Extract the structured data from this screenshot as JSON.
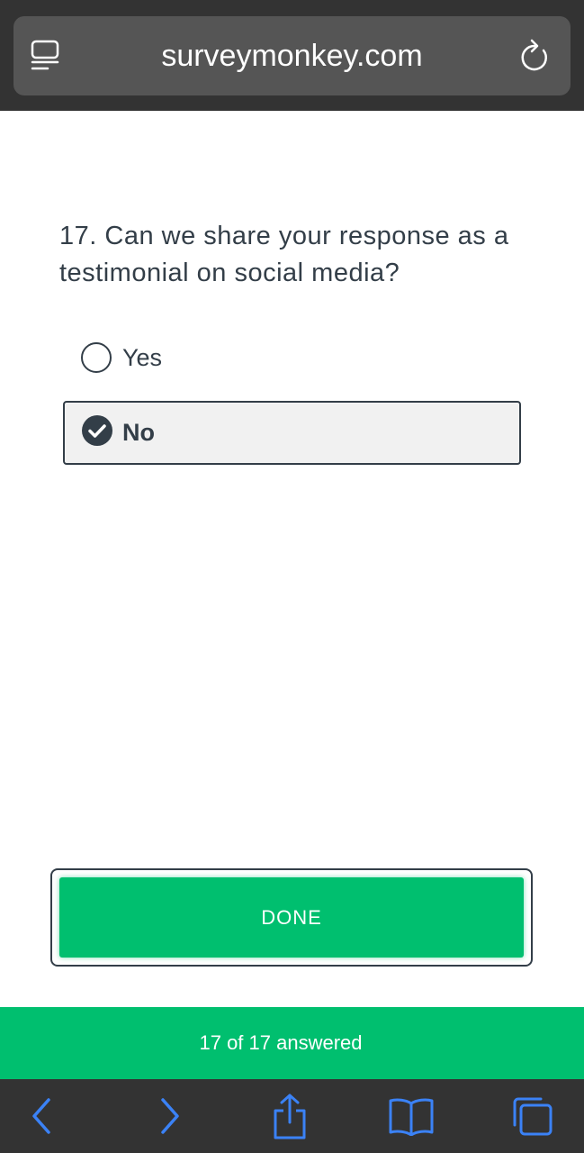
{
  "browser": {
    "url": "surveymonkey.com",
    "icons": {
      "reader": "reader-view-icon",
      "reload": "reload-icon"
    },
    "toolbar": {
      "back": "chevron-left-icon",
      "forward": "chevron-right-icon",
      "share": "share-icon",
      "bookmarks": "book-icon",
      "tabs": "tabs-icon"
    },
    "colors": {
      "bar": "#333333",
      "url_pill": "#555555",
      "toolbar_icon": "#3b82f6"
    }
  },
  "survey": {
    "question": "17. Can we share your response as a testimonial on social media?",
    "options": [
      {
        "label": "Yes",
        "selected": false
      },
      {
        "label": "No",
        "selected": true
      }
    ],
    "done_label": "DONE",
    "progress_text": "17 of 17 answered",
    "colors": {
      "accent": "#00bf6f",
      "text": "#333e48",
      "selected_bg": "#f1f1f1"
    }
  }
}
